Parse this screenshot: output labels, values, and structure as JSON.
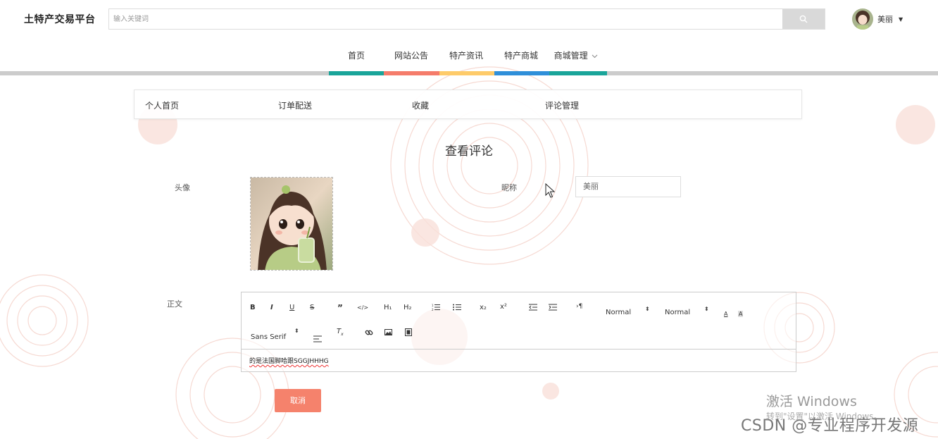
{
  "header": {
    "brand": "土特产交易平台",
    "search_placeholder": "输入关键词",
    "username": "美丽"
  },
  "nav": {
    "items": [
      "首页",
      "网站公告",
      "特产资讯",
      "特产商城",
      "商城管理"
    ],
    "bar_colors": [
      "#1aa59a",
      "#f57c6b",
      "#fecb6a",
      "#2f8fd9",
      "#1aa59a"
    ]
  },
  "tabs": [
    "个人首页",
    "订单配送",
    "收藏",
    "评论管理"
  ],
  "form": {
    "title": "查看评论",
    "avatar_label": "头像",
    "nickname_label": "昵称",
    "nickname_value": "美丽",
    "body_label": "正文",
    "body_content": "的是法国脚哈跟SGGJHHHG",
    "cancel_label": "取消"
  },
  "editor_toolbar": {
    "header_select": "Normal",
    "size_select": "Normal",
    "font_select": "Sans Serif"
  },
  "watermarks": {
    "activate_title": "激活 Windows",
    "activate_sub": "转到\"设置\"以激活 Windows。",
    "csdn": "CSDN @专业程序开发源"
  },
  "colors": {
    "accent": "#f5826c",
    "nav_bar_bg": "#cccccc"
  }
}
